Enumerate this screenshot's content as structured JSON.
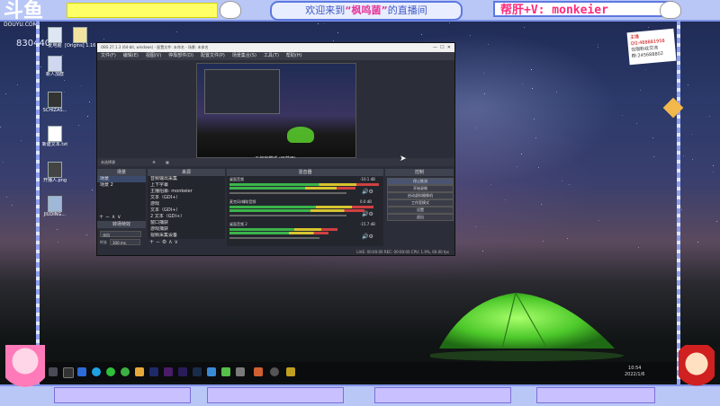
{
  "branding": {
    "logo_text": "斗鱼",
    "logo_sub": "DOUYU.COM",
    "viewer_count": "830440"
  },
  "banners": {
    "welcome_pre": "欢迎来到",
    "welcome_name": "“枫鸣菌”",
    "welcome_post": "的直播间",
    "help_text": "帮肝+V: monkeier"
  },
  "note": {
    "line1": "主播QQ:488881958",
    "line2": "仅限粉丝交流",
    "line3": "群:245688802"
  },
  "desktop_icons": [
    {
      "label": "此电脑"
    },
    {
      "label": "[Origins] 1.16.2..."
    },
    {
      "label": "新人加群"
    },
    {
      "label": "SCHIZAS..."
    },
    {
      "label": "新建文本.txt"
    },
    {
      "label": "开播人.png"
    },
    {
      "label": "JIUDING..."
    }
  ],
  "obs": {
    "title": "OBS 27.1.3 (64-bit, windows) - 配置文件: 未命名 - 场景: 未命名",
    "menu": [
      "文件(F)",
      "编辑(E)",
      "视图(V)",
      "停靠部件(D)",
      "配置文件(P)",
      "场景集合(S)",
      "工具(T)",
      "帮助(H)"
    ],
    "preview_status": "工作室模式 (已禁用)",
    "scene_bar": "未选择源",
    "docks": {
      "scenes_title": "场景",
      "sources_title": "来源",
      "mixer_title": "混音器",
      "transitions_title": "转场特效",
      "controls_title": "控制"
    },
    "scenes": [
      "场景",
      "场景 2"
    ],
    "sources": [
      "音频输出采集",
      "上下字幕",
      "主播招募: monkeier",
      "文本（GDI+）",
      "游戏",
      "文本（GDI+）",
      "2  文本（GDI+）",
      "窗口捕获",
      "游戏捕获",
      "视频采集设备"
    ],
    "mixer": [
      {
        "name": "桌面音频",
        "db": "-10.1 dB"
      },
      {
        "name": "麦克风/辅助音频",
        "db": "0.0 dB"
      },
      {
        "name": "桌面音频 2",
        "db": "-15.7 dB"
      }
    ],
    "transition": {
      "type": "淡出",
      "duration_label": "时长",
      "duration": "300 ms"
    },
    "controls": [
      "停止推流",
      "开始录制",
      "启动虚拟摄像机",
      "工作室模式",
      "设置",
      "退出"
    ],
    "status": "LIVE: 00:00:00   REC: 00:00:00   CPU: 1.9%, 60.00 fps"
  },
  "taskbar": {
    "time": "10:54",
    "date": "2022/1/6"
  },
  "colors": {
    "frame": "#b9c7f7",
    "frame_border": "#7f93e6",
    "banner_pink": "#ff2a7f",
    "banner_blue": "#3f57c8",
    "tent_green": "#5ad02c"
  }
}
